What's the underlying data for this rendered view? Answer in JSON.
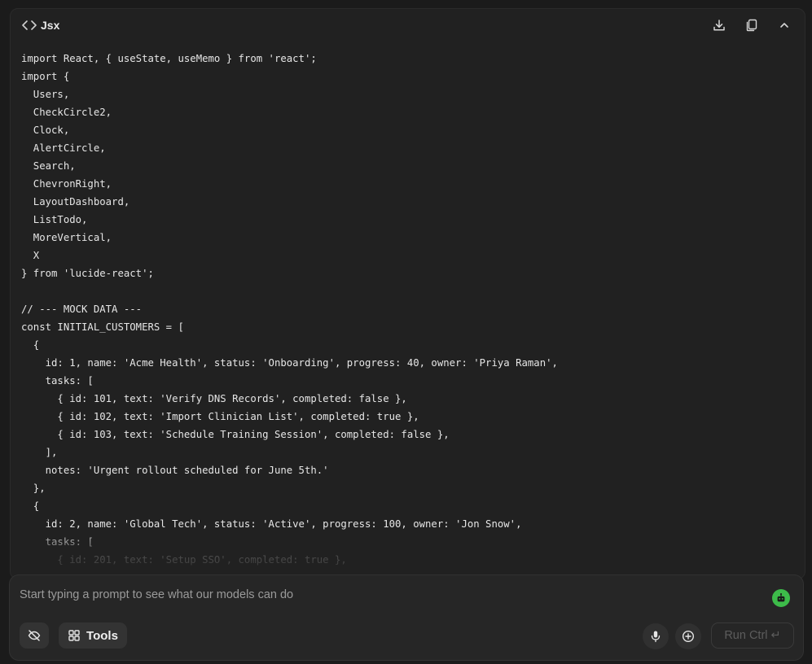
{
  "code_block": {
    "language": "Jsx",
    "download_label": "Download",
    "copy_label": "Copy",
    "collapse_label": "Collapse",
    "lines": [
      "import React, { useState, useMemo } from 'react';",
      "import {",
      "  Users,",
      "  CheckCircle2,",
      "  Clock,",
      "  AlertCircle,",
      "  Search,",
      "  ChevronRight,",
      "  LayoutDashboard,",
      "  ListTodo,",
      "  MoreVertical,",
      "  X",
      "} from 'lucide-react';",
      "",
      "// --- MOCK DATA ---",
      "const INITIAL_CUSTOMERS = [",
      "  {",
      "    id: 1, name: 'Acme Health', status: 'Onboarding', progress: 40, owner: 'Priya Raman',",
      "    tasks: [",
      "      { id: 101, text: 'Verify DNS Records', completed: false },",
      "      { id: 102, text: 'Import Clinician List', completed: true },",
      "      { id: 103, text: 'Schedule Training Session', completed: false },",
      "    ],",
      "    notes: 'Urgent rollout scheduled for June 5th.'",
      "  },",
      "  {",
      "    id: 2, name: 'Global Tech', status: 'Active', progress: 100, owner: 'Jon Snow',",
      "    tasks: [",
      "      { id: 201, text: 'Setup SSO', completed: true },"
    ]
  },
  "prompt": {
    "placeholder": "Start typing a prompt to see what our models can do",
    "value": "",
    "tools_label": "Tools",
    "run_label": "Run Ctrl ↵"
  },
  "icons": {
    "code": "code-icon",
    "download": "download-icon",
    "copy": "copy-icon",
    "collapse": "chevron-up-icon",
    "agent": "robot-icon",
    "hide": "eye-off-icon",
    "tools": "grid-icon",
    "mic": "microphone-icon",
    "add": "plus-circle-icon"
  },
  "colors": {
    "background": "#1b1b1b",
    "panel": "#212121",
    "accent_green": "#3dbb4a",
    "text": "#e6e6e6",
    "placeholder": "#9a9a9a"
  }
}
